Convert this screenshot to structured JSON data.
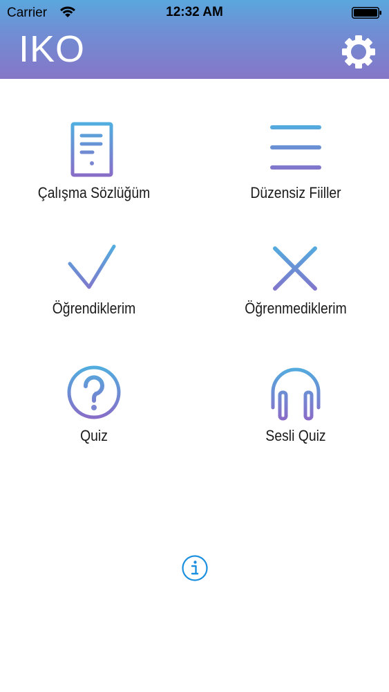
{
  "status_bar": {
    "carrier": "Carrier",
    "time": "12:32 AM"
  },
  "header": {
    "title": "IKO",
    "settings_icon": "gear-icon"
  },
  "menu": {
    "items": [
      {
        "label": "Çalışma Sözlüğüm",
        "icon": "document-icon"
      },
      {
        "label": "Düzensiz Fiiller",
        "icon": "list-icon"
      },
      {
        "label": "Öğrendiklerim",
        "icon": "checkmark-icon"
      },
      {
        "label": "Öğrenmediklerim",
        "icon": "cross-icon"
      },
      {
        "label": "Quiz",
        "icon": "question-icon"
      },
      {
        "label": "Sesli Quiz",
        "icon": "headphones-icon"
      }
    ]
  },
  "footer": {
    "info_icon": "info-icon"
  },
  "colors": {
    "gradient_top": "#5aa7dd",
    "gradient_bottom": "#8676c8",
    "info_blue": "#1a8fe0"
  }
}
